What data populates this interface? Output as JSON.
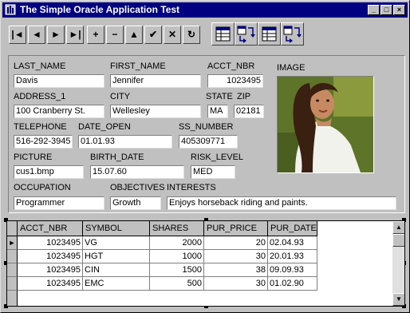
{
  "window": {
    "title": "The Simple Oracle Application Test"
  },
  "caption_buttons": [
    "_",
    "□",
    "×"
  ],
  "toolbar": {
    "nav_buttons": [
      {
        "name": "first-record-button",
        "glyph": "|◄"
      },
      {
        "name": "prior-record-button",
        "glyph": "◄"
      },
      {
        "name": "next-record-button",
        "glyph": "►"
      },
      {
        "name": "last-record-button",
        "glyph": "►|"
      },
      {
        "name": "insert-record-button",
        "glyph": "+"
      },
      {
        "name": "delete-record-button",
        "glyph": "−"
      },
      {
        "name": "edit-record-button",
        "glyph": "▲"
      },
      {
        "name": "post-record-button",
        "glyph": "✔"
      },
      {
        "name": "cancel-edit-button",
        "glyph": "✕"
      },
      {
        "name": "refresh-button",
        "glyph": "↻"
      }
    ]
  },
  "form": {
    "last_name": {
      "label": "LAST_NAME",
      "value": "Davis"
    },
    "first_name": {
      "label": "FIRST_NAME",
      "value": "Jennifer"
    },
    "acct_nbr": {
      "label": "ACCT_NBR",
      "value": "1023495"
    },
    "image": {
      "label": "IMAGE"
    },
    "address_1": {
      "label": "ADDRESS_1",
      "value": "100 Cranberry St."
    },
    "city": {
      "label": "CITY",
      "value": "Wellesley"
    },
    "state": {
      "label": "STATE",
      "value": "MA"
    },
    "zip": {
      "label": "ZIP",
      "value": "02181"
    },
    "telephone": {
      "label": "TELEPHONE",
      "value": "516-292-3945"
    },
    "date_open": {
      "label": "DATE_OPEN",
      "value": "01.01.93"
    },
    "ss_number": {
      "label": "SS_NUMBER",
      "value": "405309771"
    },
    "picture": {
      "label": "PICTURE",
      "value": "cus1.bmp"
    },
    "birth_date": {
      "label": "BIRTH_DATE",
      "value": "15.07.60"
    },
    "risk_level": {
      "label": "RISK_LEVEL",
      "value": "MED"
    },
    "occupation": {
      "label": "OCCUPATION",
      "value": "Programmer"
    },
    "objectives": {
      "label": "OBJECTIVES",
      "value": "Growth"
    },
    "interests": {
      "label": "INTERESTS",
      "value": "Enjoys horseback riding and paints."
    }
  },
  "grid": {
    "columns": [
      "ACCT_NBR",
      "SYMBOL",
      "SHARES",
      "PUR_PRICE",
      "PUR_DATE"
    ],
    "rows": [
      [
        "1023495",
        "VG",
        "2000",
        "20",
        "02.04.93"
      ],
      [
        "1023495",
        "HGT",
        "1000",
        "30",
        "20.01.93"
      ],
      [
        "1023495",
        "CIN",
        "1500",
        "38",
        "09.09.93"
      ],
      [
        "1023495",
        "EMC",
        "500",
        "30",
        "01.02.90"
      ]
    ],
    "current_row_marker": "►"
  },
  "scrollbar": {
    "up_glyph": "▲",
    "down_glyph": "▼"
  },
  "colors": {
    "titlebar": "#000080",
    "face": "#c0c0c0",
    "field": "#ffffff"
  }
}
